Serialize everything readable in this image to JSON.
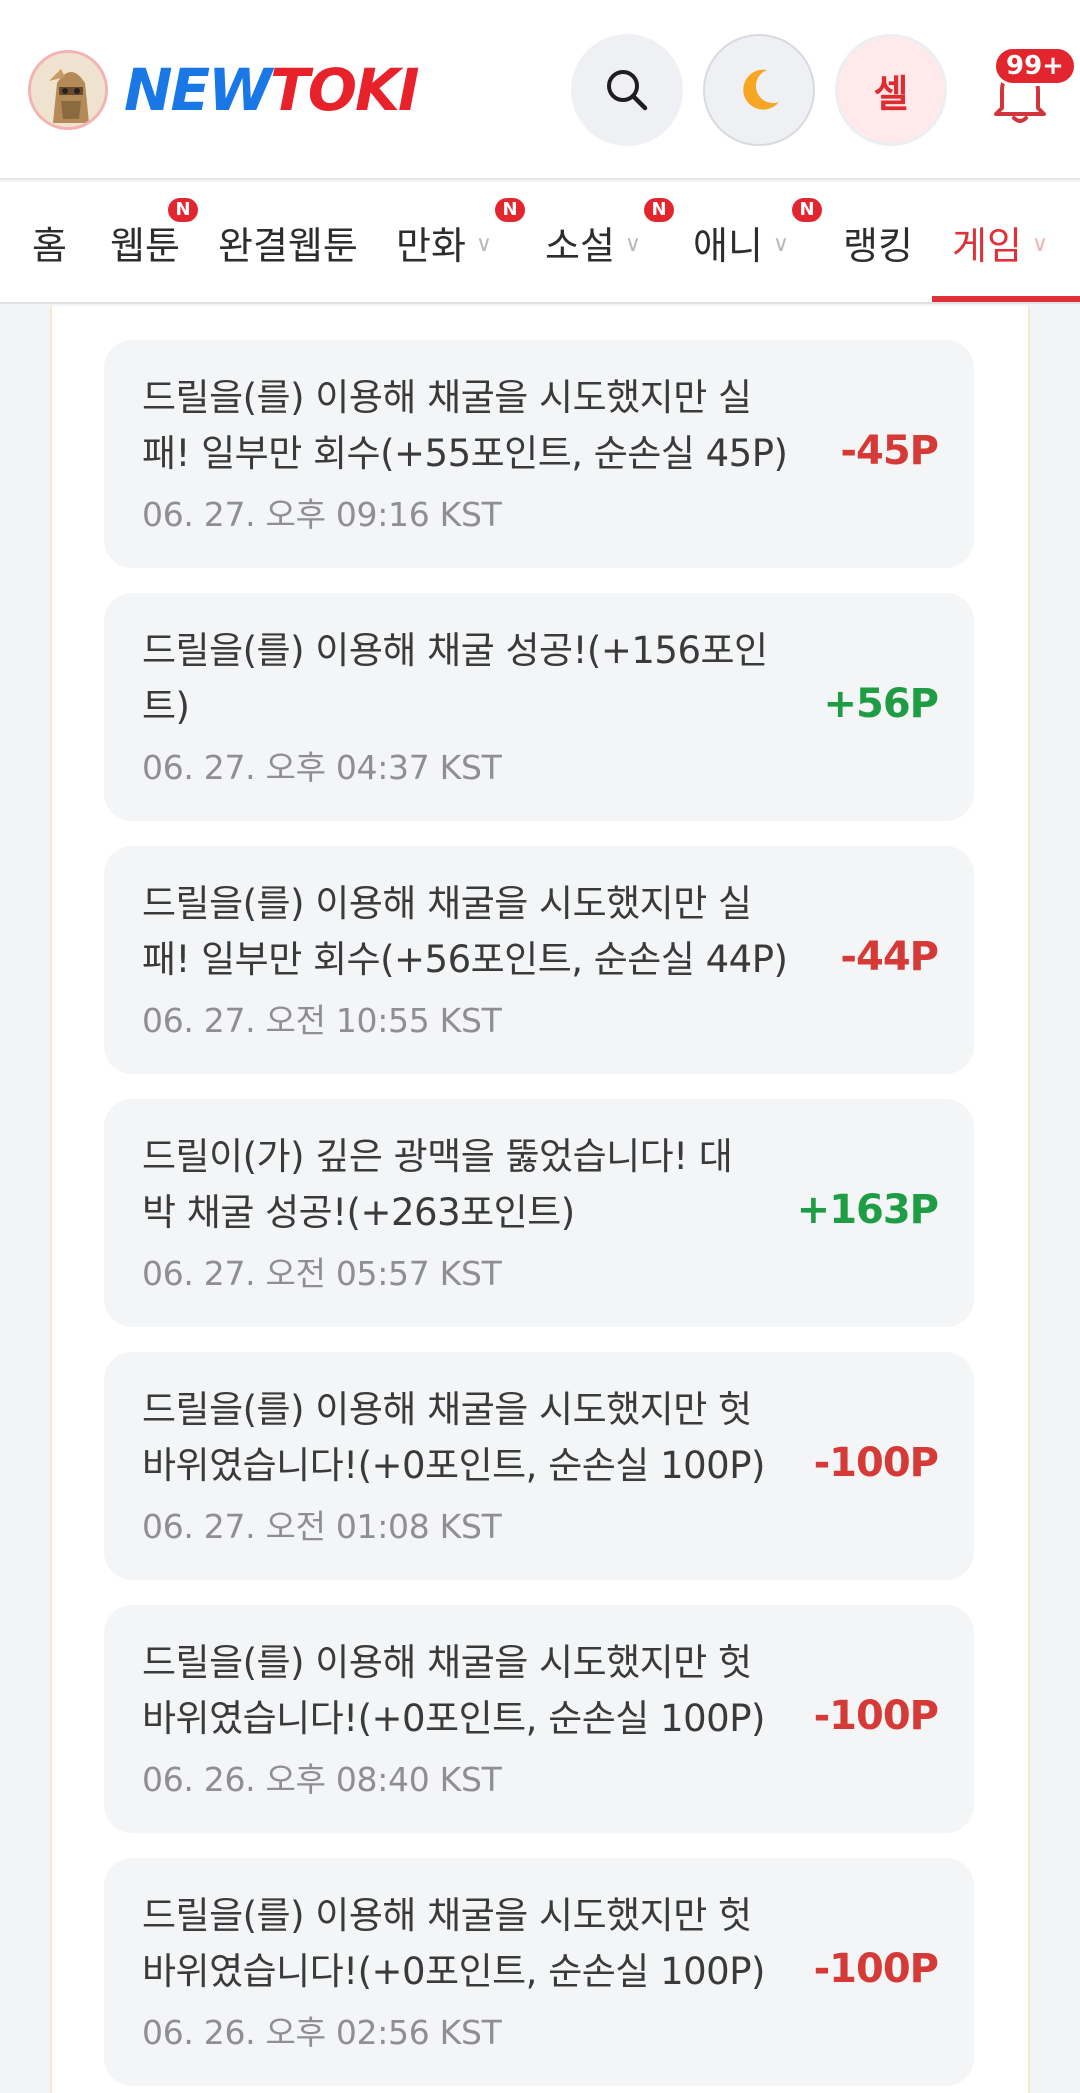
{
  "header": {
    "logo_new": "NEW",
    "logo_toki": "TOKI",
    "user_label": "셀",
    "notification_count": "99+"
  },
  "nav": {
    "items": [
      {
        "label": "홈",
        "badge": ""
      },
      {
        "label": "웹툰",
        "badge": "N"
      },
      {
        "label": "완결웹툰",
        "badge": ""
      },
      {
        "label": "만화",
        "badge": "N"
      },
      {
        "label": "소설",
        "badge": "N"
      },
      {
        "label": "애니",
        "badge": "N"
      },
      {
        "label": "랭킹",
        "badge": ""
      },
      {
        "label": "게임",
        "badge": ""
      }
    ],
    "active": "게임"
  },
  "history": [
    {
      "line1": "드릴을(를) 이용해 채굴을 시도했지만 실",
      "line2": "패! 일부만 회수(+55포인트, 순손실 45P)",
      "time": "06. 27. 오후 09:16 KST",
      "amount": "-45P",
      "type": "loss"
    },
    {
      "line1": "드릴을(를) 이용해 채굴 성공!(+156포인",
      "line2": "트)",
      "time": "06. 27. 오후 04:37 KST",
      "amount": "+56P",
      "type": "gain"
    },
    {
      "line1": "드릴을(를) 이용해 채굴을 시도했지만 실",
      "line2": "패! 일부만 회수(+56포인트, 순손실 44P)",
      "time": "06. 27. 오전 10:55 KST",
      "amount": "-44P",
      "type": "loss"
    },
    {
      "line1": "드릴이(가) 깊은 광맥을 뚫었습니다! 대",
      "line2": "박 채굴 성공!(+263포인트)",
      "time": "06. 27. 오전 05:57 KST",
      "amount": "+163P",
      "type": "gain"
    },
    {
      "line1": "드릴을(를) 이용해 채굴을 시도했지만 헛",
      "line2": "바위였습니다!(+0포인트, 순손실 100P)",
      "time": "06. 27. 오전 01:08 KST",
      "amount": "-100P",
      "type": "loss"
    },
    {
      "line1": "드릴을(를) 이용해 채굴을 시도했지만 헛",
      "line2": "바위였습니다!(+0포인트, 순손실 100P)",
      "time": "06. 26. 오후 08:40 KST",
      "amount": "-100P",
      "type": "loss"
    },
    {
      "line1": "드릴을(를) 이용해 채굴을 시도했지만 헛",
      "line2": "바위였습니다!(+0포인트, 순손실 100P)",
      "time": "06. 26. 오후 02:56 KST",
      "amount": "-100P",
      "type": "loss"
    }
  ],
  "colors": {
    "brand_blue": "#1a78e6",
    "brand_red": "#e8222b",
    "loss": "#d63a36",
    "gain": "#1f9d45"
  }
}
